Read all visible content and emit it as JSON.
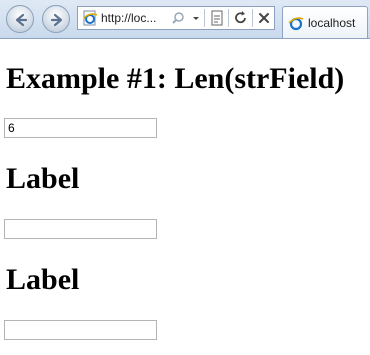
{
  "browser": {
    "address_text": "http://loc...",
    "tab_title": "localhost",
    "icons": {
      "back": "back-arrow-icon",
      "forward": "forward-arrow-icon",
      "page": "ie-page-icon",
      "search": "search-icon",
      "dropdown": "chevron-down-icon",
      "compat": "compatibility-view-icon",
      "refresh": "refresh-icon",
      "stop": "close-icon"
    }
  },
  "page": {
    "heading": "Example #1: Len(strField)",
    "field1_value": "6",
    "label1": "Label",
    "field2_value": "",
    "label2": "Label",
    "field3_value": ""
  }
}
